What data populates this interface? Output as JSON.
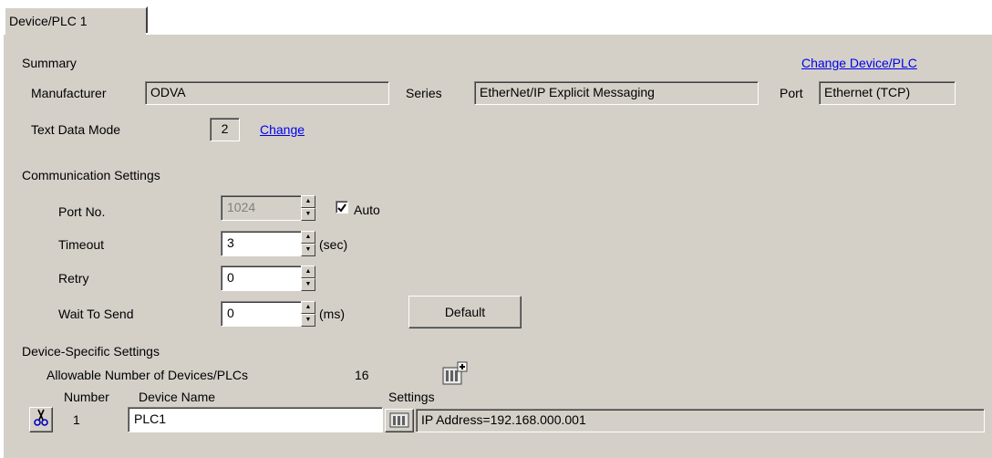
{
  "tab": {
    "label": "Device/PLC 1"
  },
  "summary": {
    "heading": "Summary",
    "change_device_link": "Change Device/PLC",
    "manufacturer_label": "Manufacturer",
    "manufacturer_value": "ODVA",
    "series_label": "Series",
    "series_value": "EtherNet/IP Explicit Messaging",
    "port_label": "Port",
    "port_value": "Ethernet (TCP)",
    "text_mode_label": "Text Data Mode",
    "text_mode_value": "2",
    "text_mode_change": "Change"
  },
  "comm": {
    "heading": "Communication Settings",
    "port_no_label": "Port No.",
    "port_no_value": "1024",
    "auto_label": "Auto",
    "auto_checked": true,
    "timeout_label": "Timeout",
    "timeout_value": "3",
    "timeout_unit": "(sec)",
    "retry_label": "Retry",
    "retry_value": "0",
    "wait_label": "Wait To Send",
    "wait_value": "0",
    "wait_unit": "(ms)",
    "default_button": "Default"
  },
  "device": {
    "heading": "Device-Specific Settings",
    "allowable_label": "Allowable Number of Devices/PLCs",
    "allowable_value": "16",
    "col_number": "Number",
    "col_device_name": "Device Name",
    "col_settings": "Settings",
    "rows": [
      {
        "number": "1",
        "name": "PLC1",
        "settings": "IP Address=192.168.000.001"
      }
    ]
  }
}
